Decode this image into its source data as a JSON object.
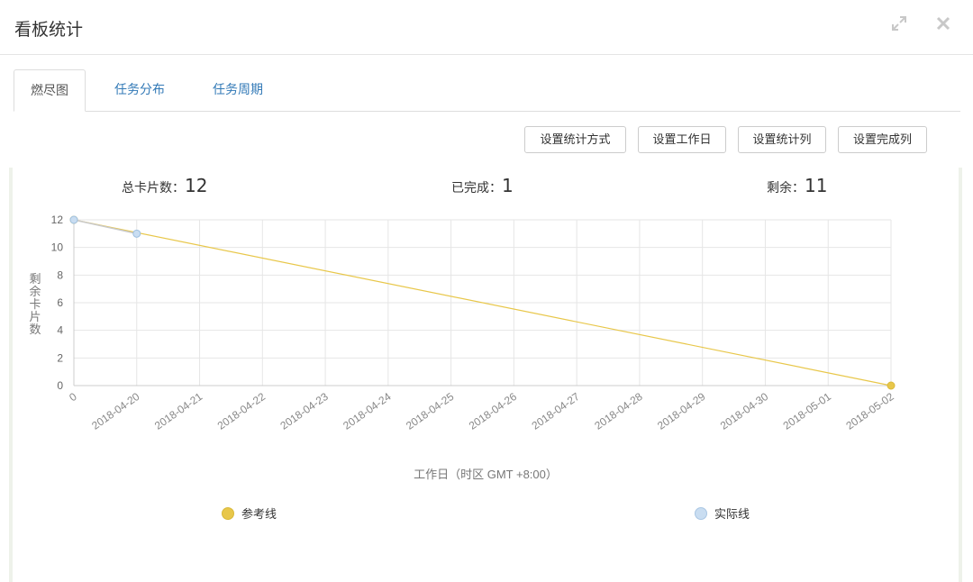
{
  "window": {
    "title": "看板统计",
    "expand_icon": "expand-icon",
    "close_icon": "close-icon"
  },
  "tabs": [
    {
      "label": "燃尽图",
      "active": true
    },
    {
      "label": "任务分布",
      "active": false
    },
    {
      "label": "任务周期",
      "active": false
    }
  ],
  "toolbar": {
    "set_stat_mode": "设置统计方式",
    "set_workday": "设置工作日",
    "set_stat_column": "设置统计列",
    "set_done_column": "设置完成列"
  },
  "stats": {
    "total_label": "总卡片数：",
    "total_value": "12",
    "done_label": "已完成：",
    "done_value": "1",
    "remaining_label": "剩余：",
    "remaining_value": "11"
  },
  "colors": {
    "reference": "#e8c74a",
    "actual": "#b8d4ee",
    "accent_link": "#337ab7"
  },
  "chart_data": {
    "type": "line",
    "ylabel": "剩余卡片数",
    "xlabel": "工作日（时区 GMT +8:00）",
    "categories": [
      "0",
      "2018-04-20",
      "2018-04-21",
      "2018-04-22",
      "2018-04-23",
      "2018-04-24",
      "2018-04-25",
      "2018-04-26",
      "2018-04-27",
      "2018-04-28",
      "2018-04-29",
      "2018-04-30",
      "2018-05-01",
      "2018-05-02"
    ],
    "yticks": [
      0,
      2,
      4,
      6,
      8,
      10,
      12
    ],
    "ylim": [
      0,
      12
    ],
    "grid": true,
    "series": [
      {
        "name": "参考线",
        "values": [
          12,
          null,
          null,
          null,
          null,
          null,
          null,
          null,
          null,
          null,
          null,
          null,
          null,
          0
        ]
      },
      {
        "name": "实际线",
        "values": [
          12,
          11,
          null,
          null,
          null,
          null,
          null,
          null,
          null,
          null,
          null,
          null,
          null,
          null
        ]
      }
    ],
    "legend": "bottom"
  }
}
